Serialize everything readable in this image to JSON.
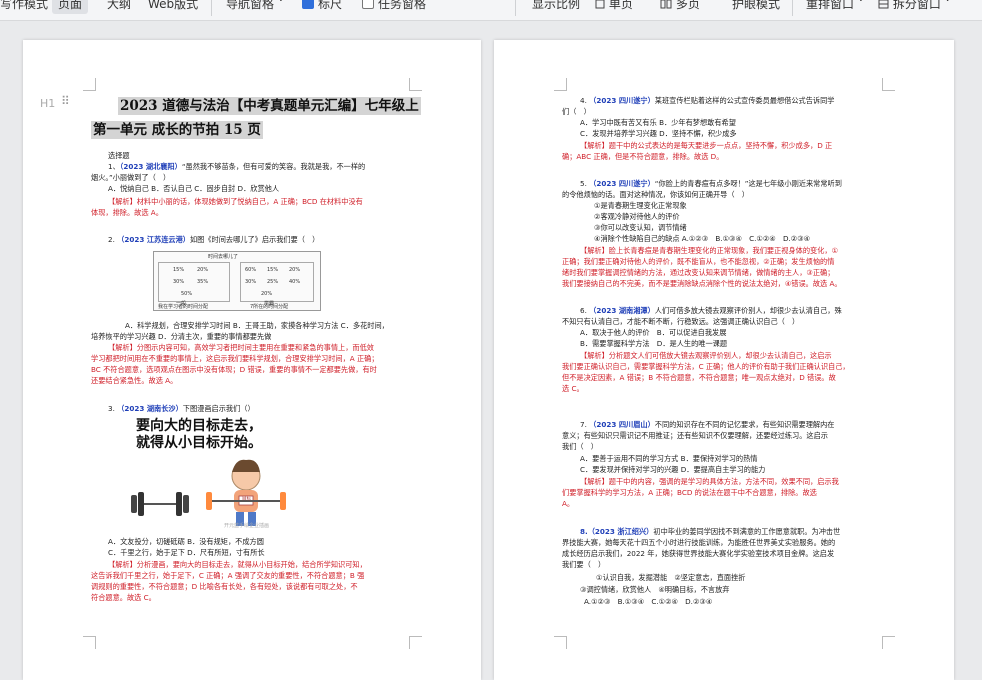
{
  "toolbar": {
    "items": [
      "写作模式",
      "页面",
      "大纲",
      "Web版式",
      "导航窗格",
      "标尺",
      "任务窗格",
      "显示比例",
      "单页",
      "多页",
      "护眼模式",
      "重排窗口",
      "拆分窗口"
    ],
    "nav_chevron": "˅",
    "ruler_checked": true,
    "task_checked": false
  },
  "page1": {
    "heading_icon": "H1",
    "title_line1": "2023 道德与法治【中考真题单元汇编】七年级上",
    "title_line2": "第一单元 成长的节拍 15 页",
    "section": "选择题",
    "q1_num": "1、",
    "q1_src": "（2023 湖北襄阳）",
    "q1_text_a": "“虽然我不够苗条，但有可爱的笑容。我就是我，不一样的",
    "q1_text_b": "烟火。”小丽做到了（　）",
    "q1_opts": "A．悦纳自己 B．否认自己 C．固步自封 D．欣赏他人",
    "q1_ans_a": "【解析】材料中小丽的话，体现她做到了悦纳自己，A 正确；BCD 在材料中没有",
    "q1_ans_b": "体现，排除。故选 A。",
    "q2_num": "2.",
    "q2_src": "（2023 江苏连云港）",
    "q2_text": "如图《时间去哪儿了》启示我们要（　）",
    "q2_chart_title": "时间去哪儿了",
    "q2_chart_cells": [
      "15%",
      "20%",
      "30%",
      "35%",
      "50%",
      "60%",
      "15%",
      "20%",
      "30%",
      "25%",
      "40%",
      "20%",
      "60%"
    ],
    "q2_chart_x": [
      "一般",
      "学霸"
    ],
    "q2_chart_caption": "我在学习者的时间分配",
    "q2_chart_caption2": "7所在的时间分配",
    "q2_opts_a": "A．科学规划，合理安排学习时间 B．王哥王助，家摸各种学习方法 C．多花时间，",
    "q2_opts_b": "培养恢平的学习兴趣 D．分清主次，重要的事情都要先做",
    "q2_ans_a": "【解析】分图示内容可知，高效学习者把时间主要用在重要和紧急的事情上，而低效",
    "q2_ans_b": "学习都把时间用在不重要的事情上，这启示我们要科学规划，合理安排学习时间，A 正确；",
    "q2_ans_c": "BC 不符合题意，选项观点在图示中没有体现；D 错误，重要的事情不一定都要先做，有时",
    "q2_ans_d": "还要结合紧急性。故选 A。",
    "q3_num": "3.",
    "q3_src": "（2023 湖南长沙）",
    "q3_text": "下图漫画启示我们（）",
    "q3_img_line1": "要向大的目标走去，",
    "q3_img_line2": "就得从小目标开始。",
    "q3_img_badge": "目标",
    "q3_img_watermark": "开元蓝手绘企业插画",
    "q3_opts_a": "A．文友投分，切磋砥砺 B．没有规矩，不成方圆",
    "q3_opts_b": "C．千里之行，始于足下 D．尺有所短，寸有所长",
    "q3_ans_a": "【解析】分析漫画，要向大的目标走去，就得从小目标开始，结合所学知识可知，",
    "q3_ans_b": "这告诉我们千里之行，始于足下，C 正确；A 强调了交友的重要性，不符合题意；B 强",
    "q3_ans_c": "调规则的重要性，不符合题意；D 比喻各有长处，各有短处，该说都有可取之处，不",
    "q3_ans_d": "符合题意。故选 C。"
  },
  "page2": {
    "q4_num": "4.",
    "q4_src": "（2023 四川遂宁）",
    "q4_text": "某班宣传栏贴着这样的公式宣传委员最想借公式告诉同学",
    "q4_text_b": "们（　）",
    "q4_optA": "A．学习中既有苦又有乐 B．少年有梦想敢有希望",
    "q4_optC": "C．发现并培养学习兴趣 D．坚持不懈，积少成多",
    "q4_ans_a": "【解析】题干中的公式表达的是每天要进步一点点，坚持不懈，积少成多，D 正",
    "q4_ans_b": "确；ABC 正确，但是不符合题意，排除。故选 D。",
    "q5_num": "5.",
    "q5_src": "（2023 四川遂宁）",
    "q5_text_a": "“你脸上的青春痘有点多呀！”这是七年级小刚近来常常听到",
    "q5_text_b": "的令他烦恼的话。面对这种情况，你该如何正确开导（　）",
    "q5_s1": "①是青春期生理变化正常现象",
    "q5_s2": "②客观冷静对待他人的评价",
    "q5_s3": "③你可以改变认知，调节情绪",
    "q5_s4": "④消除个性缺陷自己的缺点 A.①②③　B.①③④　C.①②④　D.②③④",
    "q5_ans_a": "【解析】脸上长青春痘是青春期生理变化的正常现象，我们要正视身体的变化，①",
    "q5_ans_b": "正确；我们要正确对待他人的评价，既不能盲从，也不能忽视，②正确；发生烦恼的情",
    "q5_ans_c": "绪时我们要掌握调控情绪的方法，通过改变认知来调节情绪，做情绪的主人，③正确；",
    "q5_ans_d": "我们要接纳自己的不完美，而不是要消除缺点消除个性的说法太绝对，④错误。故选 A。",
    "q6_num": "6.",
    "q6_src": "（2023 湖南湘潭）",
    "q6_text_a": "人们可借多放大镜去观察评价别人，却很少去认清自己，殊",
    "q6_text_b": "不知只有认清自己，才能不断不断，行稳致远。这强调正确认识自己（　）",
    "q6_optA": "A．取决于他人的评价　B．可以促进自我发展",
    "q6_optB": "B．需要掌握科学方法　D．是人生的唯一课题",
    "q6_ans_a": "【解析】分析题文人们可借放大镜去观察评价别人，却很少去认清自己，这启示",
    "q6_ans_b": "我们要正确认识自己，需要掌握科学方法，C 正确；他人的评价有助于我们正确认识自己，",
    "q6_ans_c": "但不是决定因素，A 错误；B 不符合题意，不符合题意；唯一观点太绝对，D 错误。故",
    "q6_ans_d": "选 C。",
    "q7_num": "7.",
    "q7_src": "（2023 四川眉山）",
    "q7_text_a": "不同的知识存在不同的记忆要求，有些知识需要理解内在",
    "q7_text_b": "意义；有些知识只需识记不用推证；还有些知识不仅要理解，还要经过练习。这启示",
    "q7_text_c": "我们（　）",
    "q7_optA": "A．要善于运用不同的学习方式 B．要保持对学习的热情",
    "q7_optC": "C．要发现并保持对学习的兴趣 D．要提高自主学习的能力",
    "q7_ans_a": "【解析】题干中的内容，强调的是学习的具体方法，方法不同，效果不同，启示我",
    "q7_ans_b": "们要掌握科学的学习方法，A 正确；BCD 的说法在题干中不合题意，排除。故选",
    "q7_ans_c": "A。",
    "q8_num": "8.",
    "q8_src": "（2023 浙江绍兴）",
    "q8_text_a": "初中毕业的姜同学因找不到满意的工作愿意就职。为冲击世",
    "q8_text_b": "界技能大赛，她每天花十四五个小时进行技能训练，为能胜任世界美丈实验服务。她的",
    "q8_text_c": "成长经历启示我们，2022 年，她获得世界技能大赛化学实验室技术项目金牌。这启发",
    "q8_text_d": "我们要（　）",
    "q8_s1": "①认识自我，发掘潜能　②坚定意志，直面挫折",
    "q8_s2": "③调控情绪，欣赏他人　④明确目标，不言放弃",
    "q8_opts": "A.①②③　B.①③④　C.①②④　D.②③④"
  }
}
